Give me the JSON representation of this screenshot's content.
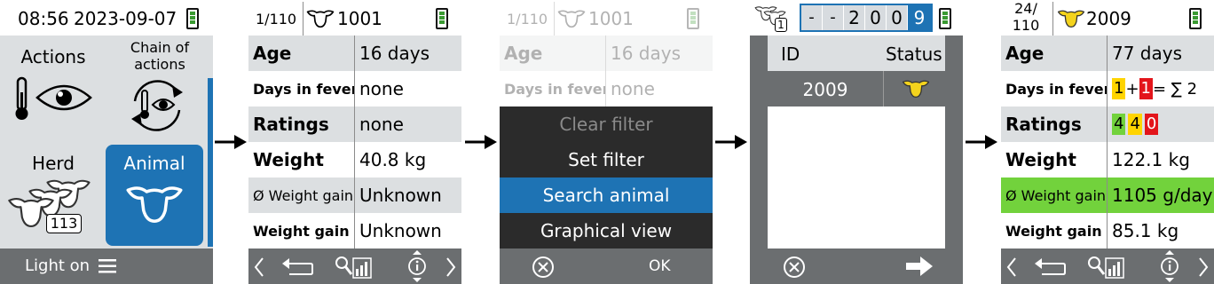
{
  "colors": {
    "accent": "#1e73b4",
    "gray_bar": "#6b6e70",
    "green": "#72d23c",
    "red": "#e3151b",
    "yellow": "#ffd400",
    "battery": "#3a9a32"
  },
  "screen1": {
    "time": "08:56",
    "date": "2023-09-07",
    "tiles": {
      "actions": "Actions",
      "chain_line1": "Chain of",
      "chain_line2": "actions",
      "herd": "Herd",
      "herd_count": "113",
      "animal": "Animal"
    },
    "bottom": {
      "light_label": "Light on",
      "menu_icon": "hamburger-icon"
    }
  },
  "screen2": {
    "counter": "1/110",
    "animal_id": "1001",
    "rows": [
      {
        "key": "Age",
        "value": "16 days"
      },
      {
        "key": "Days in fever",
        "value": "none"
      },
      {
        "key": "Ratings",
        "value": "none"
      },
      {
        "key": "Weight",
        "value": "40.8 kg"
      },
      {
        "key": "Ø Weight gain",
        "value": "Unknown"
      },
      {
        "key": "Weight gain",
        "value": "Unknown"
      }
    ]
  },
  "screen3": {
    "counter": "1/110",
    "animal_id": "1001",
    "rows": [
      {
        "key": "Age",
        "value": "16 days"
      },
      {
        "key": "Days in fever",
        "value": "none"
      }
    ],
    "menu": [
      "Clear filter",
      "Set filter",
      "Search animal",
      "Graphical view"
    ],
    "ok_label": "OK"
  },
  "screen4": {
    "herd_badge": "1",
    "digits": [
      "-",
      "-",
      "2",
      "0",
      "0",
      "9"
    ],
    "table_headers": {
      "id": "ID",
      "status": "Status"
    },
    "table_row": {
      "id": "2009"
    }
  },
  "screen5": {
    "counter_top": "24/",
    "counter_bottom": "110",
    "animal_id": "2009",
    "rows": [
      {
        "key": "Age",
        "value": "77 days"
      },
      {
        "key": "Days in fever"
      },
      {
        "key": "Ratings"
      },
      {
        "key": "Weight",
        "value": "122.1 kg"
      },
      {
        "key": "Ø Weight gain",
        "value": "1105 g/day"
      },
      {
        "key": "Weight gain",
        "value": "85.1 kg"
      }
    ],
    "fever": {
      "a": "1",
      "plus": "+",
      "b": "1",
      "eq": "= ∑ 2"
    },
    "ratings": [
      "4",
      "4",
      "0"
    ]
  }
}
